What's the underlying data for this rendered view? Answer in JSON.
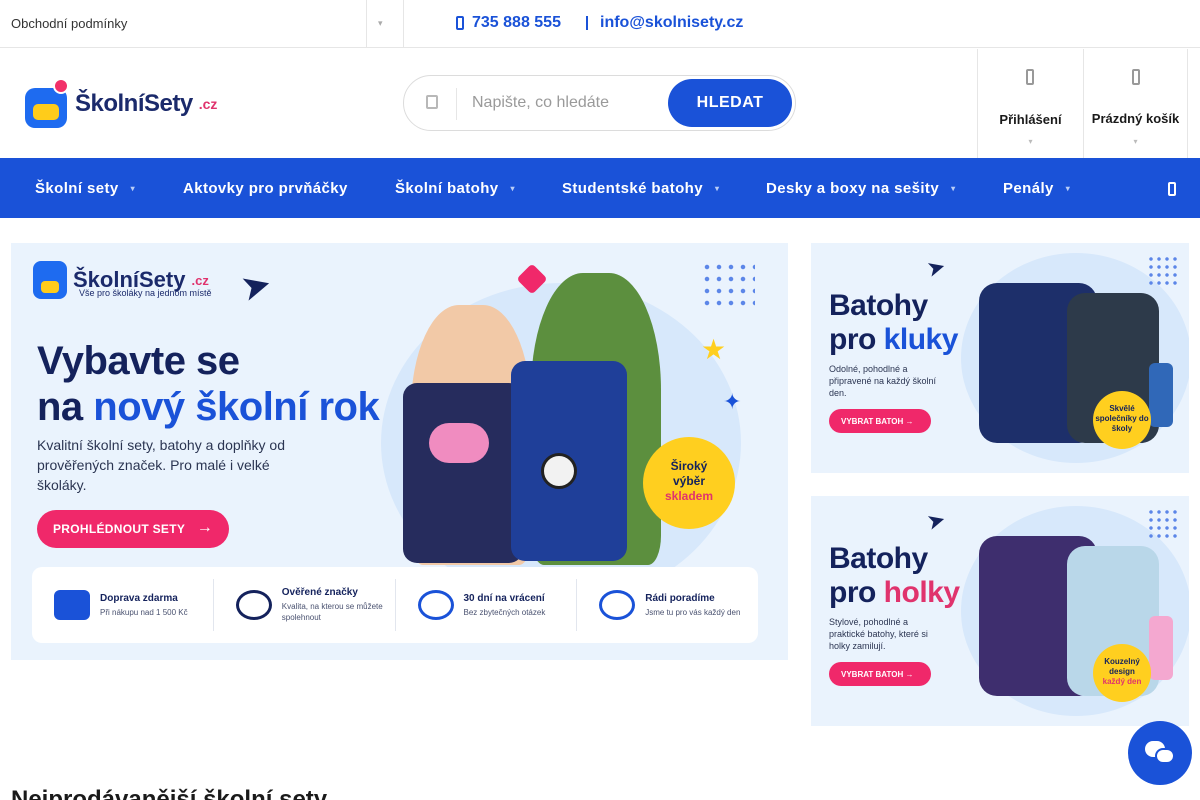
{
  "topbar": {
    "terms": "Obchodní podmínky",
    "phone": "735 888 555",
    "email": "info@skolnisety.cz"
  },
  "header": {
    "logo_name": "ŠkolníSety",
    "logo_tld": ".cz",
    "search_placeholder": "Napište, co hledáte",
    "search_button": "HLEDAT",
    "login_label": "Přihlášení",
    "cart_label": "Prázdný košík"
  },
  "nav": {
    "items": [
      {
        "label": "Školní sety",
        "has_sub": true
      },
      {
        "label": "Aktovky pro prvňáčky",
        "has_sub": false
      },
      {
        "label": "Školní batohy",
        "has_sub": true
      },
      {
        "label": "Studentské batohy",
        "has_sub": true
      },
      {
        "label": "Desky a boxy na sešity",
        "has_sub": true
      },
      {
        "label": "Penály",
        "has_sub": true
      }
    ]
  },
  "hero": {
    "logo_name": "ŠkolníSety",
    "logo_tld": ".cz",
    "logo_sub": "Vše pro školáky na jednom místě",
    "title_line1": "Vybavte se",
    "title_line2_pre": "na ",
    "title_line2_accent": "nový školní rok",
    "description": "Kvalitní školní sety, batohy a doplňky od prověřených značek. Pro malé i velké školáky.",
    "cta": "PROHLÉDNOUT SETY",
    "badge": [
      "Široký",
      "výběr",
      "skladem"
    ],
    "features": [
      {
        "title": "Doprava zdarma",
        "sub": "Při nákupu nad 1 500 Kč"
      },
      {
        "title": "Ověřené značky",
        "sub": "Kvalita, na kterou se můžete spolehnout"
      },
      {
        "title": "30 dní na vrácení",
        "sub": "Bez zbytečných otázek"
      },
      {
        "title": "Rádi poradíme",
        "sub": "Jsme tu pro vás každý den"
      }
    ]
  },
  "side_boys": {
    "title1": "Batohy",
    "title2_pre": "pro ",
    "title2_accent": "kluky",
    "description": "Odolné, pohodlné a připravené na každý školní den.",
    "cta": "VYBRAT BATOH →",
    "badge": "Skvělé společníky do školy"
  },
  "side_girls": {
    "title1": "Batohy",
    "title2_pre": "pro ",
    "title2_accent": "holky",
    "description": "Stylové, pohodlné a praktické batohy, které si holky zamilují.",
    "cta": "VYBRAT BATOH →",
    "badge_line1": "Kouzelný design",
    "badge_line2": "každý den"
  },
  "section_title": "Nejprodávanější školní sety",
  "colors": {
    "brand_blue": "#1a52d8",
    "accent_pink": "#f0286a",
    "accent_yellow": "#ffcf1f",
    "navy": "#14225c"
  }
}
